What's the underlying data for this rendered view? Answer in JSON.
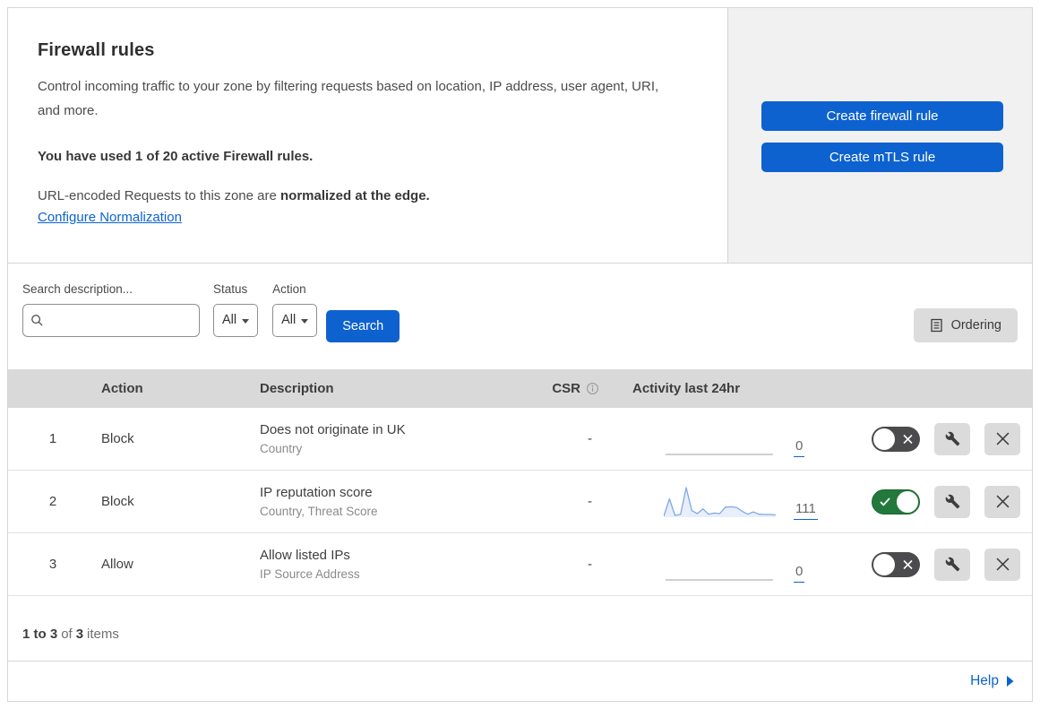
{
  "header": {
    "title": "Firewall rules",
    "description": "Control incoming traffic to your zone by filtering requests based on location, IP address, user agent, URI, and more.",
    "usage_notice": "You have used 1 of 20 active Firewall rules.",
    "normalization_prefix": "URL-encoded Requests to this zone are ",
    "normalization_bold": "normalized at the edge.",
    "normalization_link": "Configure Normalization"
  },
  "actions_panel": {
    "create_firewall_label": "Create firewall rule",
    "create_mtls_label": "Create mTLS rule"
  },
  "filters": {
    "search_label": "Search description...",
    "search_value": "",
    "status_label": "Status",
    "status_value": "All",
    "action_label": "Action",
    "action_value": "All",
    "search_button_label": "Search",
    "ordering_button_label": "Ordering"
  },
  "table": {
    "columns": {
      "action": "Action",
      "description": "Description",
      "csr": "CSR",
      "activity": "Activity last 24hr"
    },
    "rows": [
      {
        "priority": "1",
        "action": "Block",
        "description": "Does not originate in UK",
        "fields": "Country",
        "csr": "-",
        "activity_value": "0",
        "enabled": false,
        "sparkline": []
      },
      {
        "priority": "2",
        "action": "Block",
        "description": "IP reputation score",
        "fields": "Country, Threat Score",
        "csr": "-",
        "activity_value": "111",
        "enabled": true,
        "sparkline": [
          3,
          62,
          6,
          10,
          100,
          22,
          12,
          28,
          10,
          14,
          12,
          34,
          35,
          33,
          20,
          10,
          18,
          10,
          9,
          9,
          8
        ]
      },
      {
        "priority": "3",
        "action": "Allow",
        "description": "Allow listed IPs",
        "fields": "IP Source Address",
        "csr": "-",
        "activity_value": "0",
        "enabled": false,
        "sparkline": []
      }
    ],
    "footer": {
      "range_bold": "1 to 3",
      "of_label": "of",
      "total_bold": "3",
      "items_label": "items"
    }
  },
  "help": {
    "label": "Help"
  },
  "colors": {
    "accent_blue": "#0d62cf",
    "toggle_on_green": "#23793c",
    "toggle_off_gray": "#4b4b4e",
    "sparkline_blue": "#7fa8e8",
    "panel_gray": "#f1f1f2",
    "table_header_gray": "#d9d9d9"
  }
}
